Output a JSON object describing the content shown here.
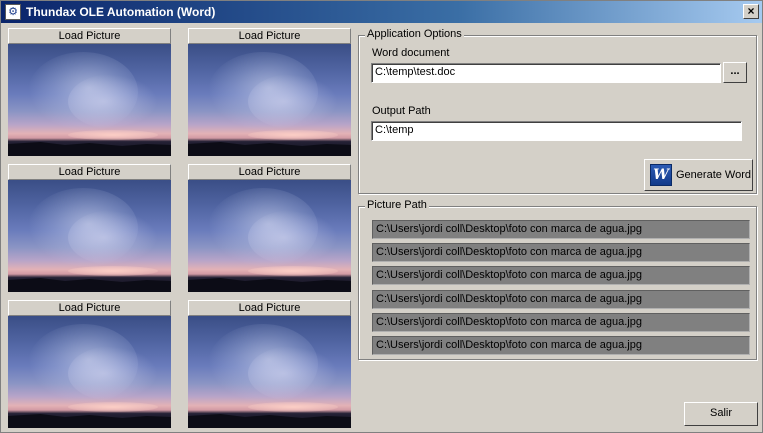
{
  "window": {
    "title": "Thundax OLE Automation (Word)",
    "close_label": "×"
  },
  "thumbnails": [
    {
      "button_label": "Load Picture"
    },
    {
      "button_label": "Load Picture"
    },
    {
      "button_label": "Load Picture"
    },
    {
      "button_label": "Load Picture"
    },
    {
      "button_label": "Load Picture"
    },
    {
      "button_label": "Load Picture"
    }
  ],
  "application_options": {
    "legend": "Application Options",
    "word_document_label": "Word document",
    "word_document_value": "C:\\temp\\test.doc",
    "browse_label": "...",
    "output_path_label": "Output Path",
    "output_path_value": "C:\\temp",
    "generate_button_label": "Generate Word",
    "generate_icon": "word-icon"
  },
  "picture_path": {
    "legend": "Picture Path",
    "paths": [
      "C:\\Users\\jordi coll\\Desktop\\foto con marca de agua.jpg",
      "C:\\Users\\jordi coll\\Desktop\\foto con marca de agua.jpg",
      "C:\\Users\\jordi coll\\Desktop\\foto con marca de agua.jpg",
      "C:\\Users\\jordi coll\\Desktop\\foto con marca de agua.jpg",
      "C:\\Users\\jordi coll\\Desktop\\foto con marca de agua.jpg",
      "C:\\Users\\jordi coll\\Desktop\\foto con marca de agua.jpg"
    ]
  },
  "footer": {
    "exit_label": "Salir"
  }
}
